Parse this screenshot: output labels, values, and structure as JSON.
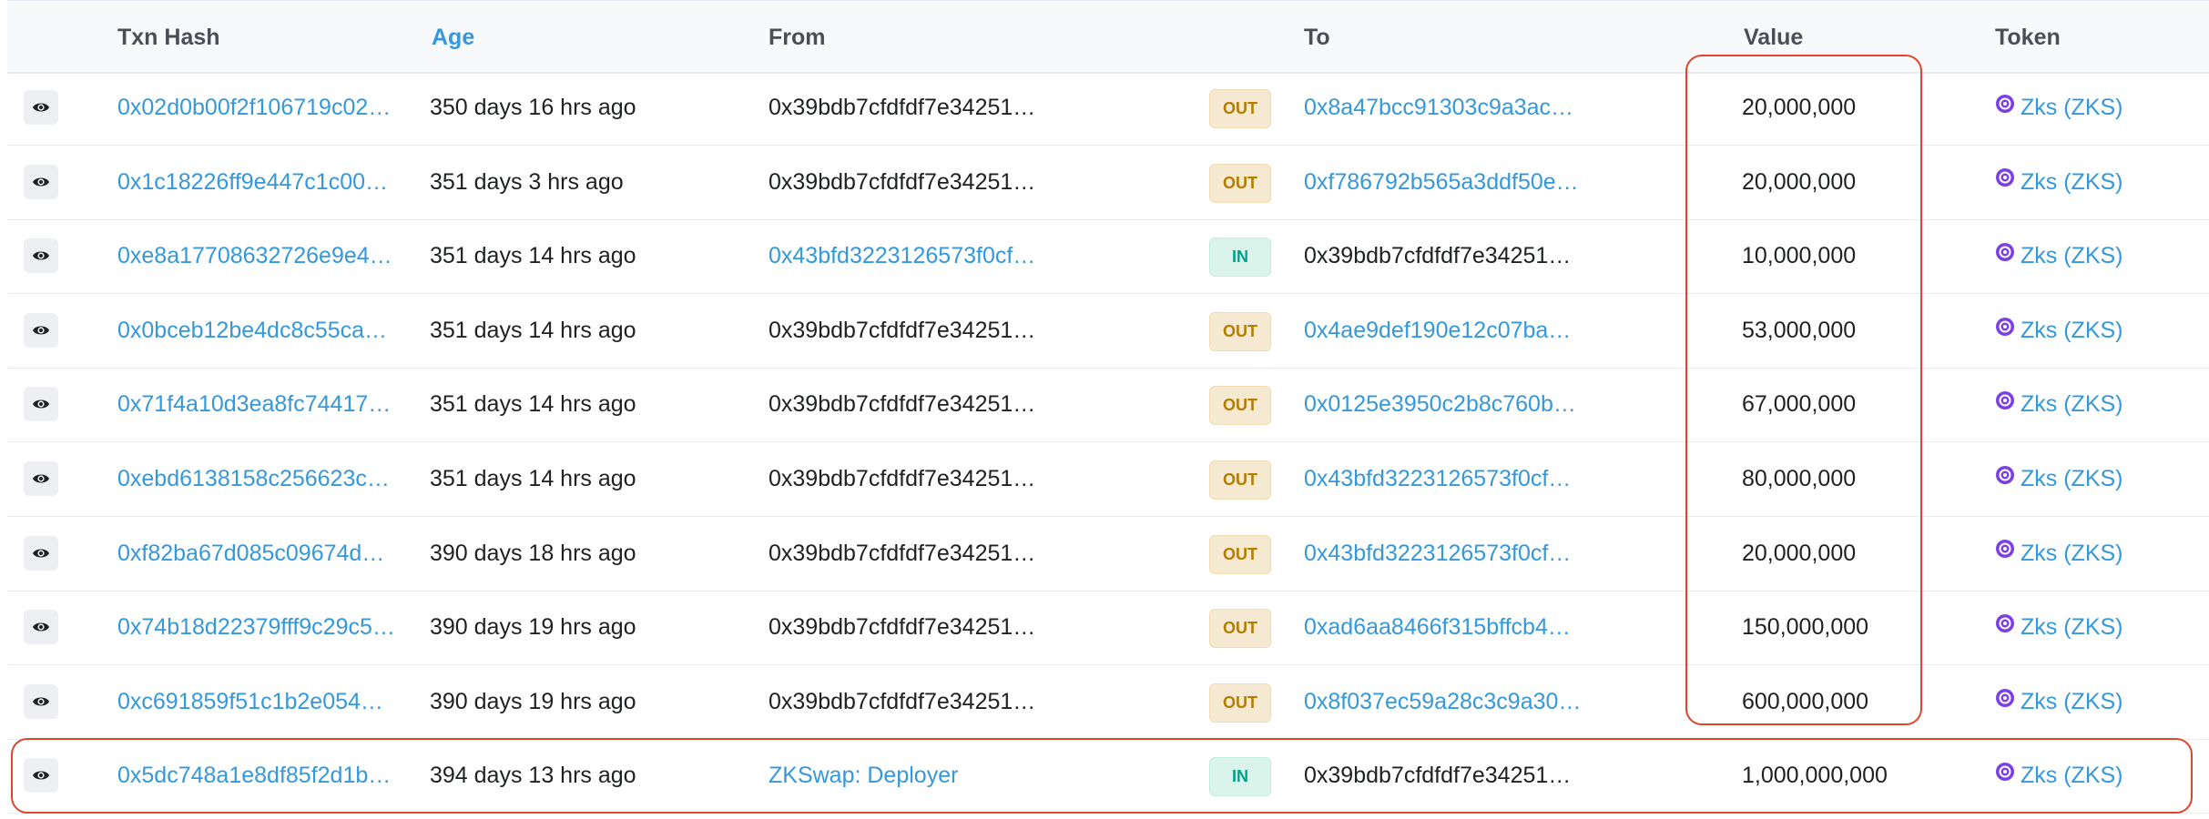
{
  "columns": {
    "txn_hash": "Txn Hash",
    "age": "Age",
    "from": "From",
    "to": "To",
    "value": "Value",
    "token": "Token"
  },
  "rows": [
    {
      "hash": "0x02d0b00f2f106719c02…",
      "age": "350 days 16 hrs ago",
      "from": "0x39bdb7cfdfdf7e34251…",
      "from_link": false,
      "direction": "OUT",
      "to": "0x8a47bcc91303c9a3ac…",
      "to_link": true,
      "value": "20,000,000",
      "token": "Zks (ZKS)"
    },
    {
      "hash": "0x1c18226ff9e447c1c00…",
      "age": "351 days 3 hrs ago",
      "from": "0x39bdb7cfdfdf7e34251…",
      "from_link": false,
      "direction": "OUT",
      "to": "0xf786792b565a3ddf50e…",
      "to_link": true,
      "value": "20,000,000",
      "token": "Zks (ZKS)"
    },
    {
      "hash": "0xe8a17708632726e9e4…",
      "age": "351 days 14 hrs ago",
      "from": "0x43bfd3223126573f0cf…",
      "from_link": true,
      "direction": "IN",
      "to": "0x39bdb7cfdfdf7e34251…",
      "to_link": false,
      "value": "10,000,000",
      "token": "Zks (ZKS)"
    },
    {
      "hash": "0x0bceb12be4dc8c55ca…",
      "age": "351 days 14 hrs ago",
      "from": "0x39bdb7cfdfdf7e34251…",
      "from_link": false,
      "direction": "OUT",
      "to": "0x4ae9def190e12c07ba…",
      "to_link": true,
      "value": "53,000,000",
      "token": "Zks (ZKS)"
    },
    {
      "hash": "0x71f4a10d3ea8fc74417…",
      "age": "351 days 14 hrs ago",
      "from": "0x39bdb7cfdfdf7e34251…",
      "from_link": false,
      "direction": "OUT",
      "to": "0x0125e3950c2b8c760b…",
      "to_link": true,
      "value": "67,000,000",
      "token": "Zks (ZKS)"
    },
    {
      "hash": "0xebd6138158c256623c…",
      "age": "351 days 14 hrs ago",
      "from": "0x39bdb7cfdfdf7e34251…",
      "from_link": false,
      "direction": "OUT",
      "to": "0x43bfd3223126573f0cf…",
      "to_link": true,
      "value": "80,000,000",
      "token": "Zks (ZKS)"
    },
    {
      "hash": "0xf82ba67d085c09674d…",
      "age": "390 days 18 hrs ago",
      "from": "0x39bdb7cfdfdf7e34251…",
      "from_link": false,
      "direction": "OUT",
      "to": "0x43bfd3223126573f0cf…",
      "to_link": true,
      "value": "20,000,000",
      "token": "Zks (ZKS)"
    },
    {
      "hash": "0x74b18d22379fff9c29c5…",
      "age": "390 days 19 hrs ago",
      "from": "0x39bdb7cfdfdf7e34251…",
      "from_link": false,
      "direction": "OUT",
      "to": "0xad6aa8466f315bffcb4…",
      "to_link": true,
      "value": "150,000,000",
      "token": "Zks (ZKS)"
    },
    {
      "hash": "0xc691859f51c1b2e054…",
      "age": "390 days 19 hrs ago",
      "from": "0x39bdb7cfdfdf7e34251…",
      "from_link": false,
      "direction": "OUT",
      "to": "0x8f037ec59a28c3c9a30…",
      "to_link": true,
      "value": "600,000,000",
      "token": "Zks (ZKS)"
    },
    {
      "hash": "0x5dc748a1e8df85f2d1b…",
      "age": "394 days 13 hrs ago",
      "from": "ZKSwap: Deployer",
      "from_link": true,
      "direction": "IN",
      "to": "0x39bdb7cfdfdf7e34251…",
      "to_link": false,
      "value": "1,000,000,000",
      "token": "Zks (ZKS)"
    }
  ],
  "colors": {
    "link": "#3498db",
    "out_badge_bg": "#f5e9d1",
    "out_badge_text": "#b47d00",
    "in_badge_bg": "#daf4ec",
    "in_badge_text": "#00a186",
    "highlight": "#e0452b",
    "token_icon": "#7b3fe4"
  }
}
